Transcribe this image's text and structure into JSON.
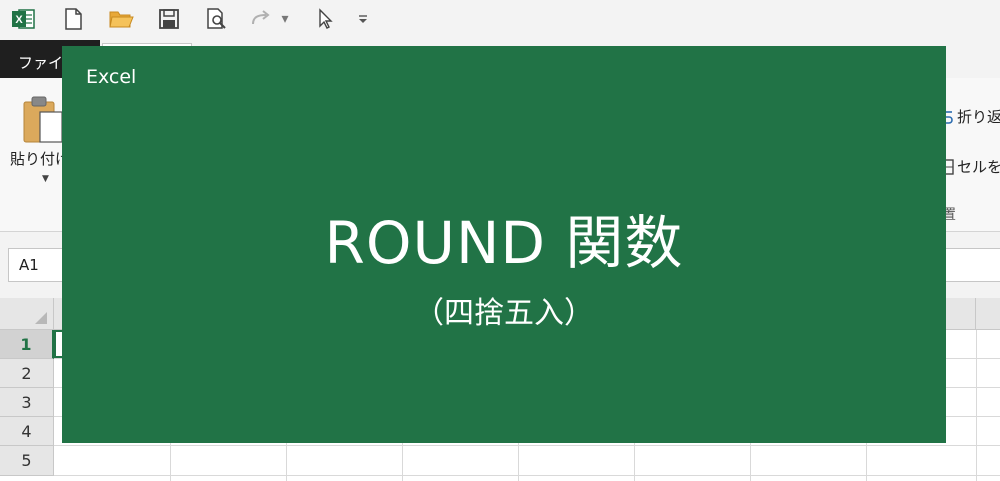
{
  "toolbar": {
    "icons": [
      "excel-logo-icon",
      "new-file-icon",
      "open-folder-icon",
      "save-icon",
      "print-preview-icon",
      "redo-icon",
      "pointer-icon",
      "customize-icon"
    ]
  },
  "tabs": {
    "file_label": "ファイル"
  },
  "ribbon": {
    "paste_label": "貼り付け",
    "wrap_text_label": "折り返",
    "merge_label": "セルを",
    "group_label": "置"
  },
  "formula_bar": {
    "name_box": "A1"
  },
  "grid": {
    "rows": [
      "1",
      "2",
      "3",
      "4",
      "5"
    ],
    "active_row": "1"
  },
  "card": {
    "app_name": "Excel",
    "title": "ROUND 関数",
    "subtitle": "（四捨五入）"
  },
  "colors": {
    "excel_green": "#217346",
    "file_tab": "#1f1f1f",
    "toolbar_bg": "#f3f3f3"
  }
}
